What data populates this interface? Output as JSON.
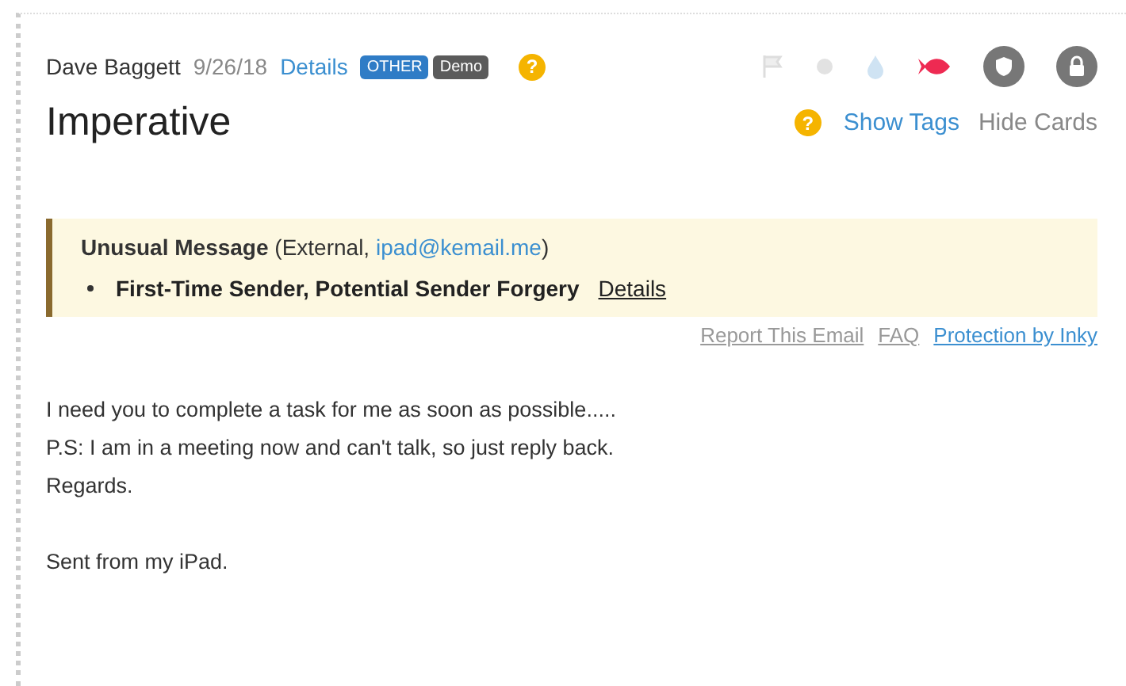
{
  "header": {
    "sender": "Dave Baggett",
    "date": "9/26/18",
    "details_link": "Details",
    "tags": [
      {
        "label": "OTHER",
        "color": "#2f7cc6"
      },
      {
        "label": "Demo",
        "color": "#5b5b5b"
      }
    ],
    "help": "?"
  },
  "toolbar": [
    {
      "kind": "flag",
      "active": false
    },
    {
      "kind": "dot",
      "active": false
    },
    {
      "kind": "drop",
      "active": false
    },
    {
      "kind": "fish",
      "active": true
    },
    {
      "kind": "shield",
      "active": true
    },
    {
      "kind": "lock",
      "active": true
    }
  ],
  "subject": "Imperative",
  "subject_actions": {
    "help": "?",
    "show_tags": "Show Tags",
    "hide_cards": "Hide Cards"
  },
  "warning": {
    "title": "Unusual Message",
    "note_before": "(External, ",
    "email": "ipad@kemail.me",
    "note_after": ")",
    "items": [
      {
        "text": "First-Time Sender, Potential Sender Forgery",
        "link": "Details"
      }
    ]
  },
  "footer_links": [
    {
      "label": "Report This Email",
      "kind": "muted"
    },
    {
      "label": "FAQ",
      "kind": "muted"
    },
    {
      "label": "Protection by Inky",
      "kind": "accent"
    }
  ],
  "body": [
    {
      "lines": [
        "I need you to complete a task for me as soon as possible.....",
        "P.S: I am in a meeting now and can't talk, so just reply back.",
        "Regards."
      ]
    },
    {
      "lines": [
        "Sent from my iPad."
      ]
    }
  ]
}
